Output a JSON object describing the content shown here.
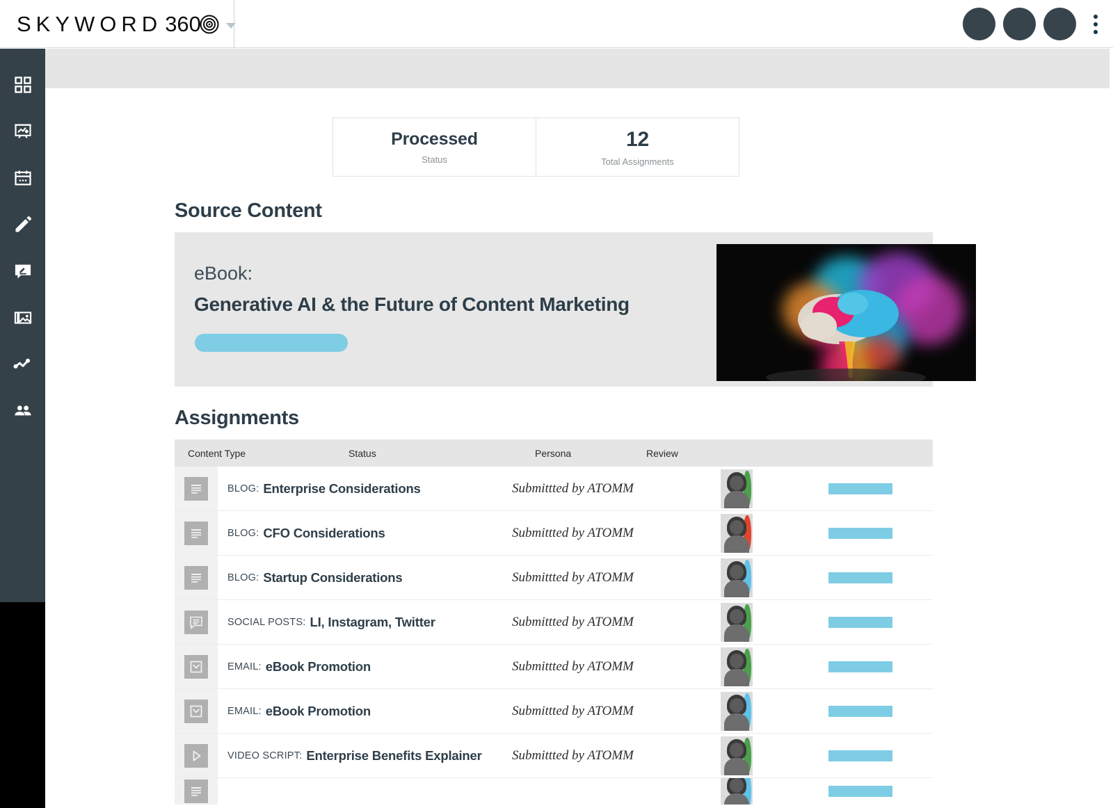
{
  "brand": {
    "name_part1": "SKYWORD",
    "name_part2": "360",
    "logo_icon": "spiral-icon",
    "dropdown_icon": "caret-down-icon"
  },
  "topbar": {
    "avatars": [
      "avatar-1",
      "avatar-2",
      "avatar-3"
    ],
    "overflow_icon": "kebab-menu-icon"
  },
  "sidebar": {
    "items": [
      {
        "name": "dashboard",
        "icon": "grid-icon"
      },
      {
        "name": "campaigns",
        "icon": "presentation-board-icon"
      },
      {
        "name": "calendar",
        "icon": "calendar-icon"
      },
      {
        "name": "create",
        "icon": "pencil-icon"
      },
      {
        "name": "review",
        "icon": "comment-edit-icon"
      },
      {
        "name": "media",
        "icon": "images-icon"
      },
      {
        "name": "analytics",
        "icon": "line-chart-icon"
      },
      {
        "name": "people",
        "icon": "people-icon"
      }
    ]
  },
  "stats": [
    {
      "value": "Processed",
      "label": "Status"
    },
    {
      "value": "12",
      "label": "Total Assignments"
    }
  ],
  "source": {
    "heading": "Source Content",
    "kicker": "eBook:",
    "title": "Generative AI & the Future of Content Marketing",
    "pill_label": "",
    "image_alt": "colorful-powder-explosion-brain"
  },
  "assignments": {
    "heading": "Assignments",
    "columns": [
      "Content Type",
      "Status",
      "Persona",
      "Review"
    ],
    "rows": [
      {
        "icon": "document-lines-icon",
        "kind": "BLOG:",
        "title": "Enterprise Considerations",
        "status": "Submittted by ATOMM",
        "persona": "persona-green",
        "persona_color": "#4aa14a",
        "review": ""
      },
      {
        "icon": "document-lines-icon",
        "kind": "BLOG:",
        "title": "CFO Considerations",
        "status": "Submittted by ATOMM",
        "persona": "persona-red",
        "persona_color": "#e0442f",
        "review": ""
      },
      {
        "icon": "document-lines-icon",
        "kind": "BLOG:",
        "title": "Startup Considerations",
        "status": "Submittted by ATOMM",
        "persona": "persona-blue",
        "persona_color": "#5ec2ea",
        "review": ""
      },
      {
        "icon": "comment-bubble-icon",
        "kind": "SOCIAL POSTS:",
        "title": "LI, Instagram, Twitter",
        "status": "Submittted by ATOMM",
        "persona": "persona-green",
        "persona_color": "#4aa14a",
        "review": ""
      },
      {
        "icon": "email-icon",
        "kind": "EMAIL:",
        "title": "eBook Promotion",
        "status": "Submittted by ATOMM",
        "persona": "persona-green",
        "persona_color": "#4aa14a",
        "review": ""
      },
      {
        "icon": "email-icon",
        "kind": "EMAIL:",
        "title": "eBook Promotion",
        "status": "Submittted by ATOMM",
        "persona": "persona-blue",
        "persona_color": "#5ec2ea",
        "review": ""
      },
      {
        "icon": "play-icon",
        "kind": "VIDEO SCRIPT:",
        "title": "Enterprise Benefits Explainer",
        "status": "Submittted by ATOMM",
        "persona": "persona-green",
        "persona_color": "#4aa14a",
        "review": ""
      },
      {
        "icon": "document-lines-icon",
        "kind": "",
        "title": "",
        "status": "",
        "persona": "persona-blue",
        "persona_color": "#5ec2ea",
        "review": ""
      }
    ]
  },
  "colors": {
    "sidebar": "#344149",
    "accent_blue": "#7ecde4",
    "heading": "#2e3e49",
    "band_gray": "#e5e5e5",
    "card_gray": "#e7e7e7"
  }
}
